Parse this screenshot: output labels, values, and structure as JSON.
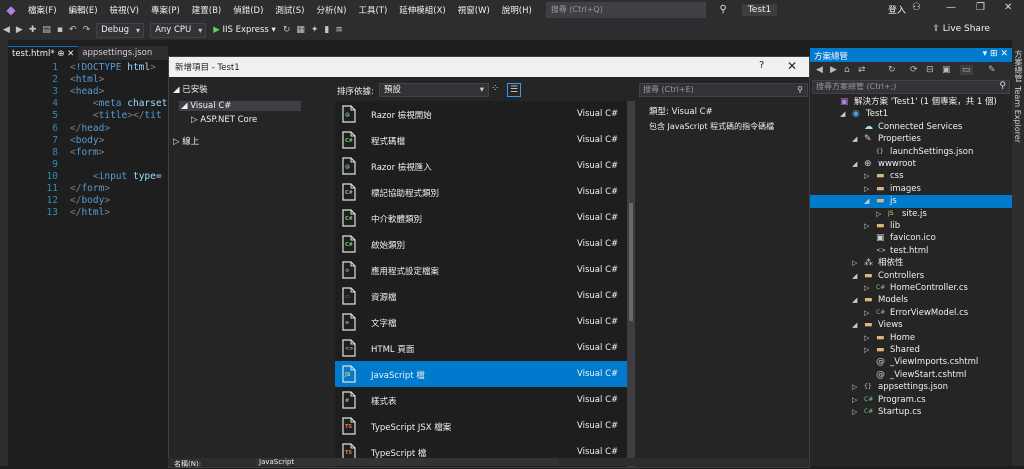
{
  "menu": {
    "items": [
      "檔案(F)",
      "編輯(E)",
      "檢視(V)",
      "專案(P)",
      "建置(B)",
      "偵錯(D)",
      "測試(S)",
      "分析(N)",
      "工具(T)",
      "延伸模組(X)",
      "視窗(W)",
      "說明(H)"
    ],
    "search_placeholder": "搜尋 (Ctrl+Q)",
    "project_name": "Test1",
    "login": "登入"
  },
  "toolbar": {
    "config": "Debug",
    "platform": "Any CPU",
    "run_label": "IIS Express",
    "live_share": "Live Share"
  },
  "editor": {
    "tabs": [
      "test.html*",
      "appsettings.json"
    ],
    "lines": [
      {
        "n": "1",
        "code": "<!DOCTYPE html>"
      },
      {
        "n": "2",
        "code": "<html>"
      },
      {
        "n": "3",
        "code": "<head>"
      },
      {
        "n": "4",
        "code": "    <meta charset"
      },
      {
        "n": "5",
        "code": "    <title></tit"
      },
      {
        "n": "6",
        "code": "</head>"
      },
      {
        "n": "7",
        "code": "<body>"
      },
      {
        "n": "8",
        "code": "<form>"
      },
      {
        "n": "9",
        "code": ""
      },
      {
        "n": "10",
        "code": "    <input type="
      },
      {
        "n": "11",
        "code": "</form>"
      },
      {
        "n": "12",
        "code": "</body>"
      },
      {
        "n": "13",
        "code": "</html>"
      }
    ]
  },
  "dialog": {
    "title": "新增項目 - Test1",
    "help": "?",
    "close": "✕",
    "categories": {
      "installed": "已安裝",
      "visual_csharp": "Visual C#",
      "aspnet_core": "ASP.NET Core",
      "online": "線上"
    },
    "sort_label": "排序依據:",
    "sort_value": "預設",
    "search_placeholder": "搜尋 (Ctrl+E)",
    "templates": [
      {
        "name": "Razor 檢視開始",
        "lang": "Visual C#",
        "icon": "razor-view-start-icon"
      },
      {
        "name": "程式碼檔",
        "lang": "Visual C#",
        "icon": "code-file-icon"
      },
      {
        "name": "Razor 檢視匯入",
        "lang": "Visual C#",
        "icon": "razor-view-imports-icon"
      },
      {
        "name": "標記協助程式類別",
        "lang": "Visual C#",
        "icon": "tag-helper-class-icon"
      },
      {
        "name": "中介軟體類別",
        "lang": "Visual C#",
        "icon": "middleware-class-icon"
      },
      {
        "name": "啟始類別",
        "lang": "Visual C#",
        "icon": "startup-class-icon"
      },
      {
        "name": "應用程式設定檔案",
        "lang": "Visual C#",
        "icon": "app-settings-icon"
      },
      {
        "name": "資源檔",
        "lang": "Visual C#",
        "icon": "resource-file-icon"
      },
      {
        "name": "文字檔",
        "lang": "Visual C#",
        "icon": "text-file-icon"
      },
      {
        "name": "HTML 頁面",
        "lang": "Visual C#",
        "icon": "html-page-icon"
      },
      {
        "name": "JavaScript 檔",
        "lang": "Visual C#",
        "icon": "javascript-file-icon"
      },
      {
        "name": "樣式表",
        "lang": "Visual C#",
        "icon": "stylesheet-icon"
      },
      {
        "name": "TypeScript JSX 檔案",
        "lang": "Visual C#",
        "icon": "typescript-jsx-icon"
      },
      {
        "name": "TypeScript 檔",
        "lang": "Visual C#",
        "icon": "typescript-file-icon"
      }
    ],
    "selected_index": 10,
    "desc_type": "類型:  Visual C#",
    "desc_text": "包含 JavaScript 程式碼的指令碼檔",
    "name_label": "名稱(N):",
    "name_value": "JavaScript"
  },
  "solution_explorer": {
    "title": "方案總管",
    "search_placeholder": "搜尋方案總管 (Ctrl+;)",
    "nodes": [
      {
        "label": "解決方案 'Test1' (1 個專案，共 1 個)",
        "indent": 0,
        "arrow": "",
        "icon": "solution-icon"
      },
      {
        "label": "Test1",
        "indent": 1,
        "arrow": "◢",
        "icon": "project-icon"
      },
      {
        "label": "Connected Services",
        "indent": 2,
        "arrow": "",
        "icon": "connected-services-icon"
      },
      {
        "label": "Properties",
        "indent": 2,
        "arrow": "◢",
        "icon": "wrench-icon"
      },
      {
        "label": "launchSettings.json",
        "indent": 3,
        "arrow": "",
        "icon": "json-file-icon"
      },
      {
        "label": "wwwroot",
        "indent": 2,
        "arrow": "◢",
        "icon": "globe-icon"
      },
      {
        "label": "css",
        "indent": 3,
        "arrow": "▷",
        "icon": "folder-icon"
      },
      {
        "label": "images",
        "indent": 3,
        "arrow": "▷",
        "icon": "folder-icon"
      },
      {
        "label": "js",
        "indent": 3,
        "arrow": "◢",
        "icon": "folder-open-icon"
      },
      {
        "label": "site.js",
        "indent": 4,
        "arrow": "▷",
        "icon": "js-file-icon"
      },
      {
        "label": "lib",
        "indent": 3,
        "arrow": "▷",
        "icon": "folder-icon"
      },
      {
        "label": "favicon.ico",
        "indent": 3,
        "arrow": "",
        "icon": "image-file-icon"
      },
      {
        "label": "test.html",
        "indent": 3,
        "arrow": "",
        "icon": "html-file-icon"
      },
      {
        "label": "相依性",
        "indent": 2,
        "arrow": "▷",
        "icon": "dependencies-icon"
      },
      {
        "label": "Controllers",
        "indent": 2,
        "arrow": "◢",
        "icon": "folder-open-icon"
      },
      {
        "label": "HomeController.cs",
        "indent": 3,
        "arrow": "▷",
        "icon": "csharp-file-icon"
      },
      {
        "label": "Models",
        "indent": 2,
        "arrow": "◢",
        "icon": "folder-open-icon"
      },
      {
        "label": "ErrorViewModel.cs",
        "indent": 3,
        "arrow": "▷",
        "icon": "csharp-file-icon"
      },
      {
        "label": "Views",
        "indent": 2,
        "arrow": "◢",
        "icon": "folder-open-icon"
      },
      {
        "label": "Home",
        "indent": 3,
        "arrow": "▷",
        "icon": "folder-icon"
      },
      {
        "label": "Shared",
        "indent": 3,
        "arrow": "▷",
        "icon": "folder-icon"
      },
      {
        "label": "_ViewImports.cshtml",
        "indent": 3,
        "arrow": "",
        "icon": "cshtml-file-icon"
      },
      {
        "label": "_ViewStart.cshtml",
        "indent": 3,
        "arrow": "",
        "icon": "cshtml-file-icon"
      },
      {
        "label": "appsettings.json",
        "indent": 2,
        "arrow": "▷",
        "icon": "json-file-icon"
      },
      {
        "label": "Program.cs",
        "indent": 2,
        "arrow": "▷",
        "icon": "csharp-file-icon"
      },
      {
        "label": "Startup.cs",
        "indent": 2,
        "arrow": "▷",
        "icon": "csharp-file-icon"
      }
    ],
    "selected_index": 8
  },
  "right_strip": {
    "tab1": "方案總管",
    "tab2": "Team Explorer"
  },
  "colors": {
    "accent": "#007acc",
    "chrome": "#2d2d30",
    "editor_bg": "#1e1e1e",
    "keyword": "#569cd6"
  }
}
